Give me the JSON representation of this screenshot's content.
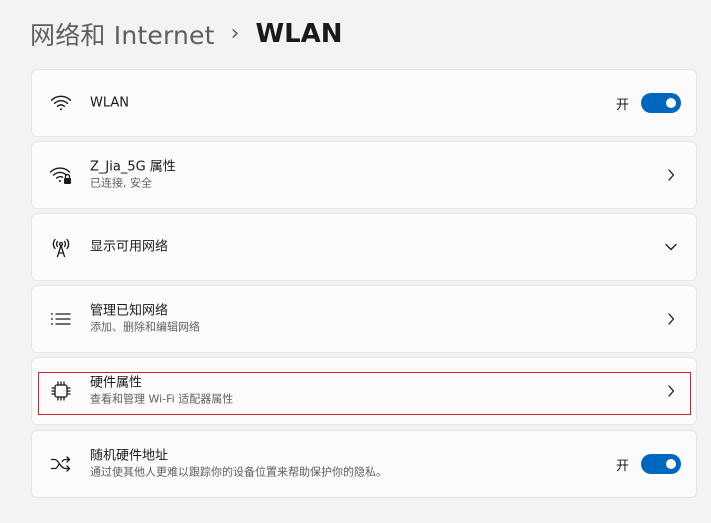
{
  "breadcrumb": {
    "parent": "网络和 Internet",
    "separator": "›",
    "current": "WLAN"
  },
  "wlan_toggle": {
    "title": "WLAN",
    "state_label": "开",
    "on": true,
    "icon": "wifi-icon"
  },
  "network_properties": {
    "title": "Z_Jia_5G 属性",
    "subtitle": "已连接, 安全",
    "icon": "wifi-secure-icon"
  },
  "available_networks": {
    "title": "显示可用网络",
    "icon": "antenna-icon"
  },
  "manage_known": {
    "title": "管理已知网络",
    "subtitle": "添加、删除和编辑网络",
    "icon": "list-icon"
  },
  "hardware_properties": {
    "title": "硬件属性",
    "subtitle": "查看和管理 Wi-Fi 适配器属性",
    "icon": "chip-icon"
  },
  "random_hw": {
    "title": "随机硬件地址",
    "subtitle": "通过使其他人更难以跟踪你的设备位置来帮助保护你的隐私。",
    "state_label": "开",
    "on": true,
    "icon": "shuffle-icon"
  },
  "colors": {
    "accent": "#0067c0",
    "highlight": "#d4232f"
  }
}
